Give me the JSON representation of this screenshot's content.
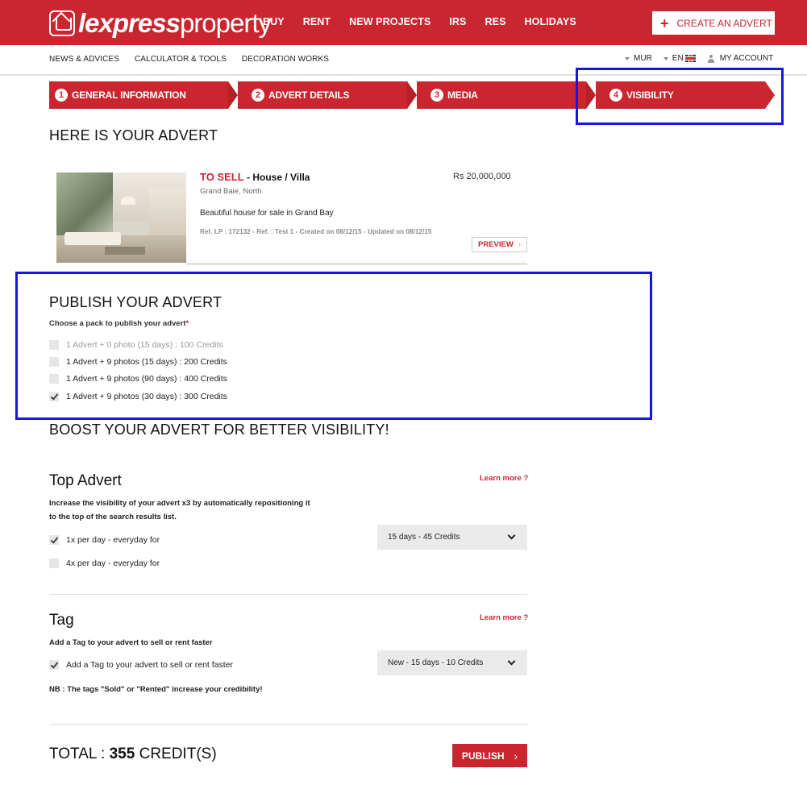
{
  "brand": {
    "bold": "lexpress",
    "light": "property"
  },
  "nav": {
    "items": [
      "BUY",
      "RENT",
      "NEW PROJECTS",
      "IRS",
      "RES",
      "HOLIDAYS"
    ]
  },
  "create_advert": {
    "icon": "plus-icon",
    "label": "CREATE AN ADVERT"
  },
  "subnav": {
    "items": [
      "NEWS & ADVICES",
      "CALCULATOR & TOOLS",
      "DECORATION WORKS"
    ],
    "currency": "MUR",
    "language": "EN",
    "account": "MY ACCOUNT"
  },
  "steps": [
    {
      "num": "1",
      "label": "GENERAL INFORMATION"
    },
    {
      "num": "2",
      "label": "ADVERT DETAILS"
    },
    {
      "num": "3",
      "label": "MEDIA"
    },
    {
      "num": "4",
      "label": "VISIBILITY"
    }
  ],
  "advert": {
    "heading": "HERE IS YOUR ADVERT",
    "status": "TO SELL",
    "kind": " - House / Villa",
    "price": "Rs 20,000,000",
    "location": "Grand Baie, North",
    "description": "Beautiful house for sale in Grand Bay",
    "ref": "Ref. LP : 172132 - Ref. : Test 1 - Created on 08/12/15 - Updated on 08/12/15",
    "preview": "PREVIEW",
    "chevron": "›"
  },
  "publish": {
    "heading": "PUBLISH YOUR ADVERT",
    "label": "Choose a pack to publish your advert",
    "required": "*",
    "options": [
      {
        "label": "1 Advert + 0 photo (15 days) : 100 Credits",
        "checked": false,
        "disabled": true
      },
      {
        "label": "1 Advert + 9 photos (15 days) : 200 Credits",
        "checked": false,
        "disabled": false
      },
      {
        "label": "1 Advert + 9 photos (90 days) : 400 Credits",
        "checked": false,
        "disabled": false
      },
      {
        "label": "1 Advert + 9 photos (30 days) : 300 Credits",
        "checked": true,
        "disabled": false
      }
    ]
  },
  "boost": {
    "heading": "BOOST YOUR ADVERT FOR BETTER VISIBILITY!",
    "top": {
      "title": "Top Advert",
      "learn": "Learn more ?",
      "description": "Increase the visibility of your advert x3 by automatically repositioning it to the top of the search results list.",
      "options": [
        {
          "label": "1x per day - everyday for",
          "checked": true
        },
        {
          "label": "4x per day - everyday for",
          "checked": false
        }
      ],
      "select": "15 days - 45 Credits"
    },
    "tag": {
      "title": "Tag",
      "learn": "Learn more ?",
      "description": "Add a Tag to your advert to sell or rent faster",
      "option": {
        "label": "Add a Tag to your advert to sell or rent faster",
        "checked": true
      },
      "select": "New - 15 days - 10 Credits",
      "note": "NB : The tags \"Sold\" or \"Rented\" increase your credibility!"
    }
  },
  "total": {
    "prefix": "TOTAL : ",
    "value": "355",
    "suffix": " CREDIT(S)"
  },
  "publish_button": {
    "label": "PUBLISH",
    "chevron": "›"
  },
  "colors": {
    "brand": "#c9262f",
    "focus": "#1515e6"
  }
}
